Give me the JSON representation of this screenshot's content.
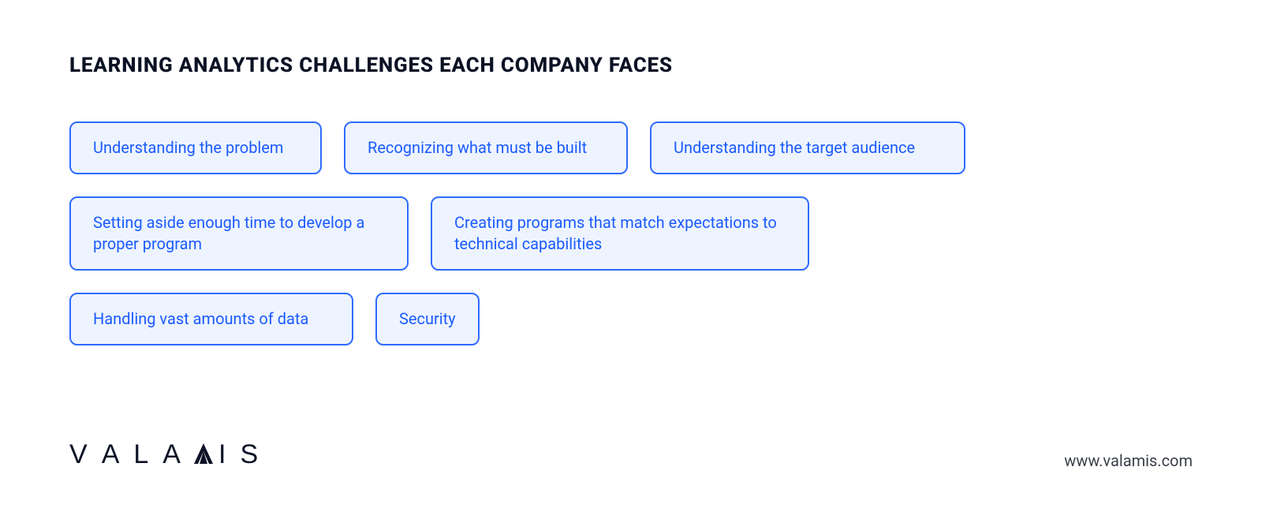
{
  "title": "LEARNING ANALYTICS CHALLENGES EACH COMPANY FACES",
  "rows": [
    {
      "items": [
        {
          "label": "Understanding the problem",
          "size": "w-m"
        },
        {
          "label": "Recognizing what must be built",
          "size": "w-ml"
        },
        {
          "label": "Understanding the target audience",
          "size": "w-l"
        }
      ]
    },
    {
      "items": [
        {
          "label": "Setting aside enough time to develop a proper program",
          "size": "w-xl"
        },
        {
          "label": "Creating programs that match expectations to technical capabilities",
          "size": "w-xxl"
        }
      ]
    },
    {
      "items": [
        {
          "label": "Handling vast amounts of data",
          "size": "w-ml"
        },
        {
          "label": "Security",
          "size": "w-s"
        }
      ]
    }
  ],
  "brand": {
    "name": "VALAMIS"
  },
  "url": "www.valamis.com"
}
